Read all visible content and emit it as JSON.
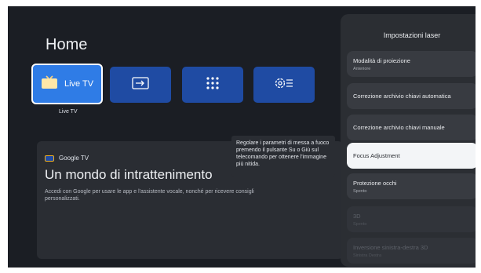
{
  "home": {
    "title": "Home",
    "tiles": [
      {
        "label": "Live TV",
        "icon": "live-tv-icon"
      },
      {
        "icon": "input-source-icon"
      },
      {
        "icon": "apps-grid-icon"
      },
      {
        "icon": "settings-icon"
      }
    ],
    "focused_tile_caption": "Live TV"
  },
  "card": {
    "brand": "Google TV",
    "heading": "Un mondo di intrattenimento",
    "body": "Accedi con Google per usare le app e l'assistente vocale, nonché per ricevere consigli personalizzati."
  },
  "tooltip": {
    "text": "Regolare i parametri di messa a fuoco premendo il pulsante Su o Giù sul telecomando per ottenere l'immagine più nitida."
  },
  "panel": {
    "title": "Impostazioni laser",
    "items": [
      {
        "label": "Modalità di proiezione",
        "sub": "Anteriore"
      },
      {
        "label": "Correzione archivio chiavi automatica"
      },
      {
        "label": "Correzione archivio chiavi manuale"
      },
      {
        "label": "Focus Adjustment",
        "state": "focused"
      },
      {
        "label": "Protezione occhi",
        "sub": "Spento"
      },
      {
        "label": "3D",
        "sub": "Spento",
        "state": "disabled"
      },
      {
        "label": "Inversione sinistra-destra 3D",
        "sub": "Sinistra Destra",
        "state": "disabled"
      }
    ]
  },
  "colors": {
    "background": "#1b1e24",
    "tile_blue": "#1f4ba3",
    "tile_focused": "#2f7ce6",
    "panel": "#2b2e33",
    "panel_item": "#383b41",
    "focused_item": "#f3f5f7",
    "google_tv_accent": "#f2b01e"
  }
}
